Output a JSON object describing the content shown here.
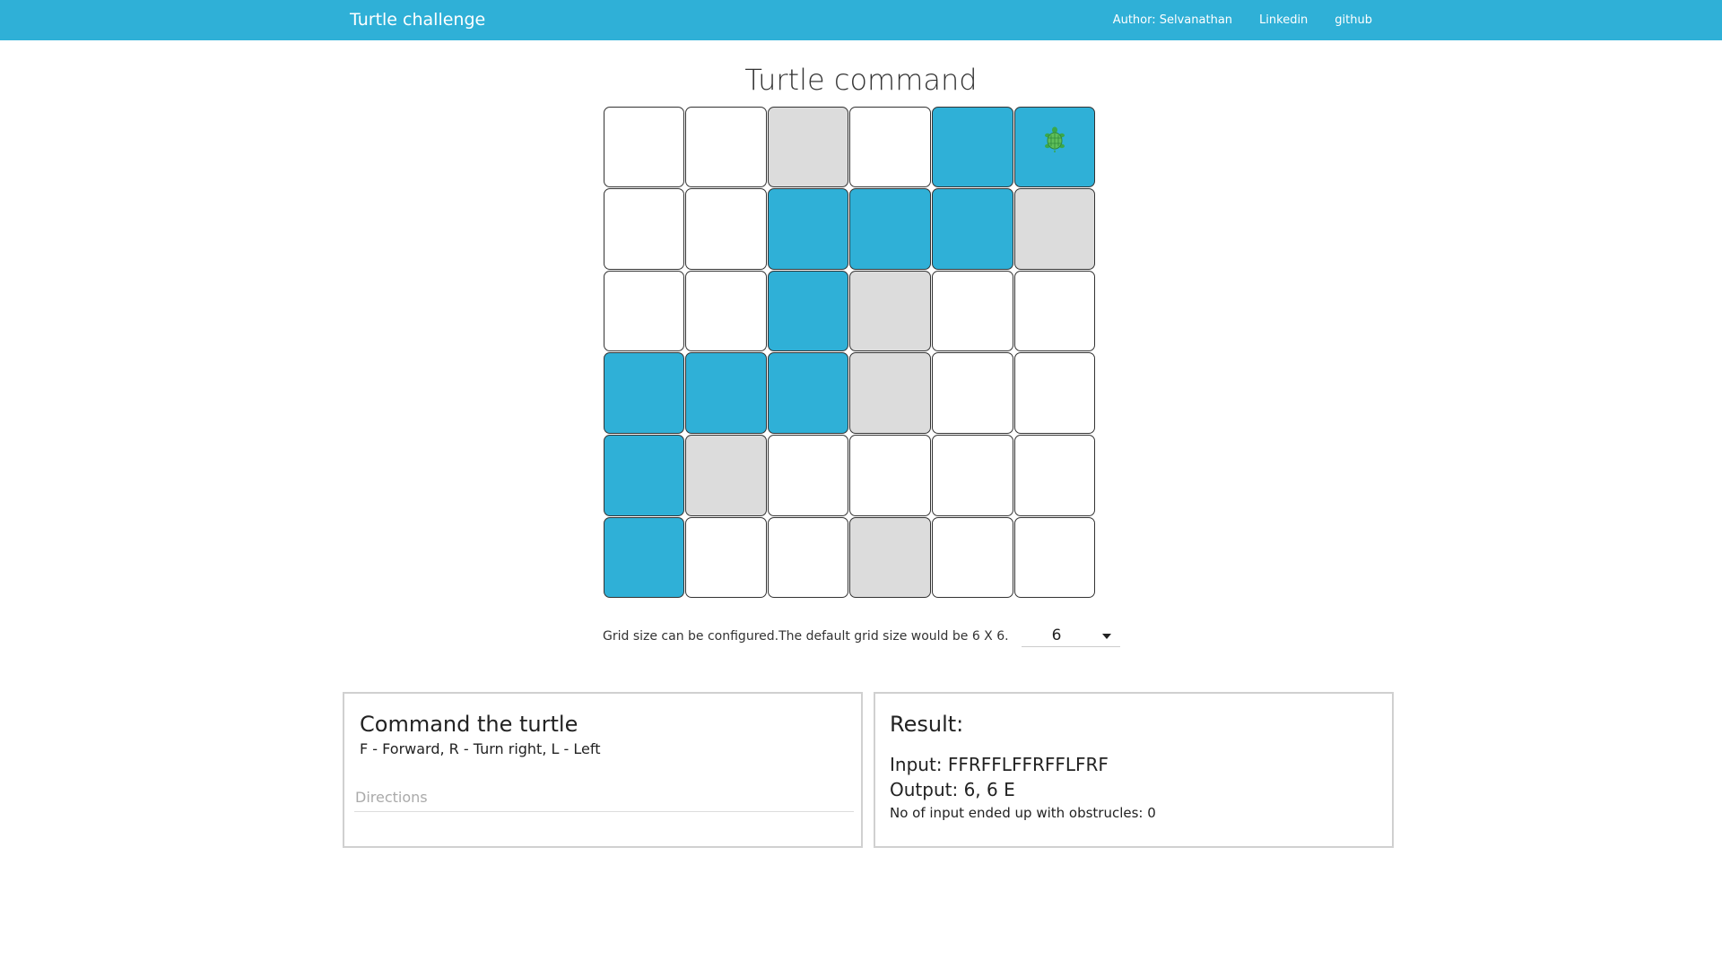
{
  "navbar": {
    "brand": "Turtle challenge",
    "links": [
      "Author: Selvanathan",
      "Linkedin",
      "github"
    ]
  },
  "page_title": "Turtle command",
  "grid": {
    "size": 6,
    "cells": [
      [
        "empty",
        "empty",
        "obstacle",
        "empty",
        "path",
        "turtle"
      ],
      [
        "empty",
        "empty",
        "path",
        "path",
        "path",
        "obstacle"
      ],
      [
        "empty",
        "empty",
        "path",
        "obstacle",
        "empty",
        "empty"
      ],
      [
        "path",
        "path",
        "path",
        "obstacle",
        "empty",
        "empty"
      ],
      [
        "path",
        "obstacle",
        "empty",
        "empty",
        "empty",
        "empty"
      ],
      [
        "path",
        "empty",
        "empty",
        "obstacle",
        "empty",
        "empty"
      ]
    ],
    "colors": {
      "path": "#2fb0d7",
      "obstacle": "#dcdcdc",
      "empty": "#ffffff",
      "turtle": "#2fb0d7"
    },
    "turtle_icon": "turtle-icon"
  },
  "grid_config": {
    "text": "Grid size can be configured.The default grid size would be 6 X 6.",
    "selected": "6"
  },
  "command": {
    "title": "Command the turtle",
    "hint": "F - Forward, R - Turn right, L - Left",
    "placeholder": "Directions"
  },
  "result": {
    "title": "Result:",
    "input_line": "Input: FFRFFLFFRFFLFRF",
    "output_line": "Output: 6, 6 E",
    "obstructs_line": "No of input ended up with obstrucles: 0"
  }
}
